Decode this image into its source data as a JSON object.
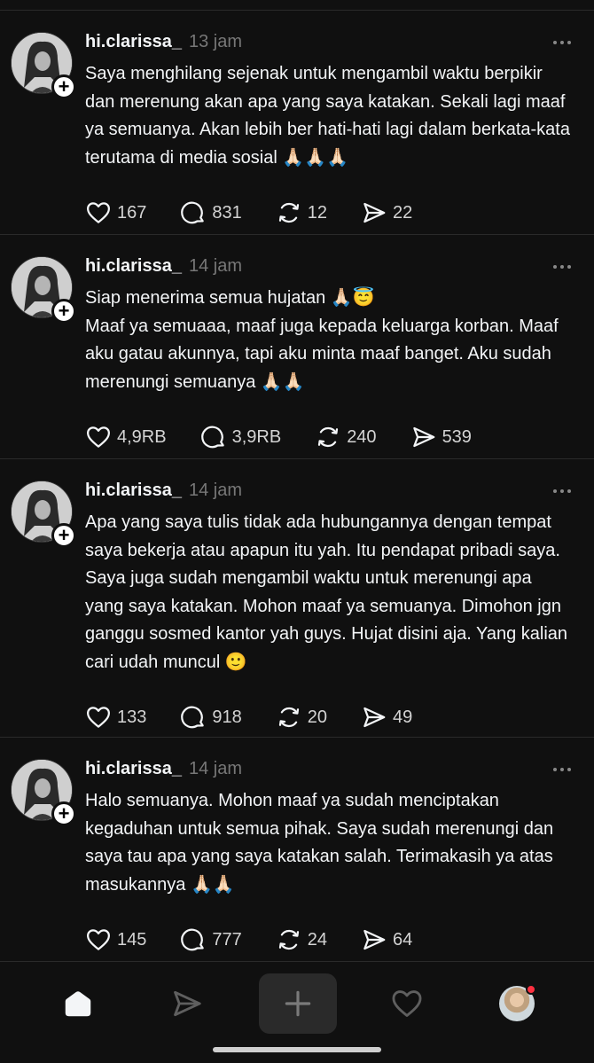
{
  "posts": [
    {
      "username": "hi.clarissa_",
      "time": "13 jam",
      "text": "Saya menghilang sejenak untuk mengambil waktu berpikir dan merenung akan apa yang saya katakan. Sekali lagi maaf ya semuanya. Akan lebih ber hati-hati lagi dalam berkata-kata terutama di media sosial 🙏🏻🙏🏻🙏🏻",
      "likes": "167",
      "replies": "831",
      "reposts": "12",
      "shares": "22"
    },
    {
      "username": "hi.clarissa_",
      "time": "14 jam",
      "text": "Siap menerima semua hujatan 🙏🏻😇\nMaaf ya semuaaa, maaf juga kepada keluarga korban. Maaf aku gatau akunnya, tapi aku minta maaf banget. Aku sudah merenungi semuanya 🙏🏻🙏🏻",
      "likes": "4,9RB",
      "replies": "3,9RB",
      "reposts": "240",
      "shares": "539"
    },
    {
      "username": "hi.clarissa_",
      "time": "14 jam",
      "text": "Apa yang saya tulis tidak ada hubungannya dengan tempat saya bekerja atau apapun itu yah. Itu pendapat pribadi saya. Saya juga sudah mengambil waktu untuk merenungi apa yang saya katakan. Mohon maaf ya semuanya. Dimohon jgn ganggu sosmed kantor yah guys. Hujat disini aja. Yang kalian cari udah muncul 🙂",
      "likes": "133",
      "replies": "918",
      "reposts": "20",
      "shares": "49"
    },
    {
      "username": "hi.clarissa_",
      "time": "14 jam",
      "text": "Halo semuanya. Mohon maaf ya sudah menciptakan kegaduhan untuk semua pihak. Saya sudah merenungi dan saya tau apa yang saya katakan salah. Terimakasih ya atas masukannya 🙏🏻🙏🏻",
      "likes": "145",
      "replies": "777",
      "reposts": "24",
      "shares": "64"
    }
  ],
  "icons": {
    "like": "heart-icon",
    "reply": "comment-icon",
    "repost": "repost-icon",
    "share": "send-icon",
    "more": "more-dots-icon",
    "follow": "plus-icon"
  },
  "tabbar": {
    "items": [
      "home-icon",
      "send-icon",
      "plus-icon",
      "heart-icon",
      "profile-avatar"
    ]
  },
  "colors": {
    "background": "#101010",
    "text": "#f3f5f7",
    "muted": "#777777",
    "divider": "#2a2a2a",
    "notification": "#ff3040"
  }
}
